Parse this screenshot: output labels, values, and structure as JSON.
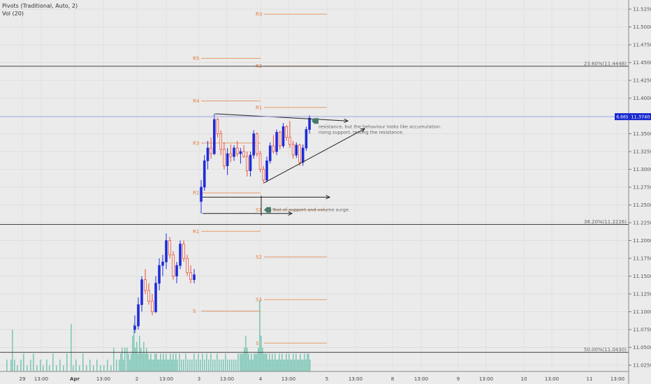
{
  "legend": {
    "pivots": "Pivots (Traditional, Auto, 2)",
    "vol": "Vol (20)"
  },
  "chart_data": {
    "type": "candlestick",
    "price_axis": {
      "ylim": [
        11.025,
        11.53
      ],
      "ticks": [
        "11.5250",
        "11.5000",
        "11.4750",
        "11.4500",
        "11.4250",
        "11.4000",
        "11.3750",
        "11.3500",
        "11.3250",
        "11.3000",
        "11.2750",
        "11.2500",
        "11.2250",
        "11.2000",
        "11.1750",
        "11.1500",
        "11.1250",
        "11.1000",
        "11.0750",
        "11.0500",
        "11.0250"
      ]
    },
    "time_axis": {
      "labels": [
        "29",
        "13:00",
        "Apr",
        "13:00",
        "2",
        "13:00",
        "3",
        "13:00",
        "4",
        "13:00",
        "5",
        "13:00",
        "8",
        "13:00",
        "9",
        "13:00",
        "10",
        "13:00",
        "11",
        "13:00"
      ]
    },
    "current_price": {
      "countdown": "6.665",
      "price": "11.3740"
    },
    "fib_levels": [
      {
        "label": "23.60%(11.4448)",
        "value": 11.4448
      },
      {
        "label": "38.20%(11.2226)",
        "value": 11.2226
      },
      {
        "label": "50.00%(11.0430)",
        "value": 11.043
      }
    ],
    "pivot_levels": [
      {
        "label": "R3",
        "value": 11.518,
        "day": 3
      },
      {
        "label": "R5",
        "value": 11.456,
        "day": 2
      },
      {
        "label": "R2",
        "value": 11.445,
        "day": 3
      },
      {
        "label": "R4",
        "value": 11.396,
        "day": 2
      },
      {
        "label": "R1",
        "value": 11.387,
        "day": 3
      },
      {
        "label": "R3",
        "value": 11.337,
        "day": 2
      },
      {
        "label": "R2",
        "value": 11.267,
        "day": 2
      },
      {
        "label": "S1",
        "value": 11.243,
        "day": 3
      },
      {
        "label": "R1",
        "value": 11.213,
        "day": 2
      },
      {
        "label": "S2",
        "value": 11.177,
        "day": 3
      },
      {
        "label": "S3",
        "value": 11.117,
        "day": 3
      },
      {
        "label": "S",
        "value": 11.101,
        "day": 2
      },
      {
        "label": "S",
        "value": 11.056,
        "day": 3
      }
    ],
    "annotations": [
      {
        "line1": "resistance, but the behaviour looks like accumulation.",
        "line2": "rising support, testing the resistance."
      },
      {
        "line1": "Test of support and volume surge."
      }
    ],
    "candles_early": [
      [
        11.075,
        11.095,
        11.07,
        11.08
      ],
      [
        11.08,
        11.12,
        11.075,
        11.11
      ],
      [
        11.11,
        11.15,
        11.1,
        11.145
      ],
      [
        11.145,
        11.16,
        11.125,
        11.13
      ],
      [
        11.13,
        11.14,
        11.11,
        11.115
      ],
      [
        11.115,
        11.125,
        11.095,
        11.1
      ],
      [
        11.1,
        11.15,
        11.098,
        11.14
      ],
      [
        11.14,
        11.175,
        11.13,
        11.165
      ],
      [
        11.165,
        11.18,
        11.15,
        11.17
      ],
      [
        11.17,
        11.21,
        11.16,
        11.2
      ],
      [
        11.2,
        11.205,
        11.175,
        11.18
      ],
      [
        11.18,
        11.185,
        11.145,
        11.15
      ],
      [
        11.15,
        11.17,
        11.14,
        11.165
      ],
      [
        11.165,
        11.2,
        11.16,
        11.195
      ],
      [
        11.195,
        11.2,
        11.17,
        11.175
      ],
      [
        11.175,
        11.18,
        11.15,
        11.155
      ],
      [
        11.155,
        11.165,
        11.14,
        11.145
      ],
      [
        11.145,
        11.16,
        11.14,
        11.152
      ]
    ],
    "candles_triangle": [
      [
        11.255,
        11.285,
        11.238,
        11.275
      ],
      [
        11.275,
        11.32,
        11.27,
        11.312
      ],
      [
        11.312,
        11.34,
        11.3,
        11.33
      ],
      [
        11.33,
        11.345,
        11.315,
        11.322
      ],
      [
        11.322,
        11.378,
        11.32,
        11.37
      ],
      [
        11.37,
        11.372,
        11.345,
        11.35
      ],
      [
        11.35,
        11.355,
        11.32,
        11.328
      ],
      [
        11.328,
        11.338,
        11.3,
        11.305
      ],
      [
        11.305,
        11.33,
        11.292,
        11.322
      ],
      [
        11.322,
        11.335,
        11.31,
        11.318
      ],
      [
        11.318,
        11.334,
        11.312,
        11.33
      ],
      [
        11.33,
        11.34,
        11.318,
        11.322
      ],
      [
        11.322,
        11.33,
        11.308,
        11.325
      ],
      [
        11.325,
        11.334,
        11.316,
        11.318
      ],
      [
        11.318,
        11.325,
        11.29,
        11.298
      ],
      [
        11.298,
        11.325,
        11.29,
        11.32
      ],
      [
        11.32,
        11.355,
        11.315,
        11.35
      ],
      [
        11.35,
        11.352,
        11.318,
        11.322
      ],
      [
        11.322,
        11.326,
        11.296,
        11.3
      ],
      [
        11.3,
        11.305,
        11.28,
        11.285
      ],
      [
        11.285,
        11.318,
        11.282,
        11.312
      ],
      [
        11.312,
        11.338,
        11.308,
        11.333
      ],
      [
        11.333,
        11.348,
        11.322,
        11.325
      ],
      [
        11.325,
        11.356,
        11.32,
        11.352
      ],
      [
        11.352,
        11.354,
        11.328,
        11.333
      ],
      [
        11.333,
        11.365,
        11.33,
        11.36
      ],
      [
        11.36,
        11.362,
        11.34,
        11.345
      ],
      [
        11.345,
        11.368,
        11.33,
        11.335
      ],
      [
        11.335,
        11.34,
        11.315,
        11.32
      ],
      [
        11.32,
        11.338,
        11.316,
        11.334
      ],
      [
        11.334,
        11.336,
        11.305,
        11.31
      ],
      [
        11.31,
        11.335,
        11.305,
        11.33
      ],
      [
        11.33,
        11.36,
        11.326,
        11.356
      ],
      [
        11.356,
        11.376,
        11.35,
        11.372
      ]
    ],
    "volume": [
      [
        9,
        2
      ],
      [
        15,
        2
      ],
      [
        17,
        7
      ],
      [
        20,
        2
      ],
      [
        24,
        1
      ],
      [
        29,
        2
      ],
      [
        33,
        3
      ],
      [
        38,
        1
      ],
      [
        43,
        2
      ],
      [
        47,
        3
      ],
      [
        52,
        1
      ],
      [
        57,
        2
      ],
      [
        61,
        1
      ],
      [
        66,
        2
      ],
      [
        70,
        1
      ],
      [
        75,
        3
      ],
      [
        80,
        1
      ],
      [
        85,
        2
      ],
      [
        90,
        1
      ],
      [
        95,
        3
      ],
      [
        101,
        8
      ],
      [
        104,
        1
      ],
      [
        108,
        2
      ],
      [
        113,
        1
      ],
      [
        118,
        3
      ],
      [
        123,
        1
      ],
      [
        128,
        2
      ],
      [
        133,
        1
      ],
      [
        138,
        2
      ],
      [
        143,
        1
      ],
      [
        148,
        1
      ],
      [
        153,
        2
      ],
      [
        158,
        1
      ],
      [
        162,
        4
      ],
      [
        166,
        2
      ],
      [
        170,
        2
      ],
      [
        172,
        3
      ],
      [
        174,
        4
      ],
      [
        176,
        2
      ],
      [
        178,
        4
      ],
      [
        181,
        4
      ],
      [
        183,
        3
      ],
      [
        185,
        2
      ],
      [
        187,
        3
      ],
      [
        189,
        6
      ],
      [
        191,
        8
      ],
      [
        193,
        4
      ],
      [
        195,
        5
      ],
      [
        197,
        3
      ],
      [
        199,
        6
      ],
      [
        201,
        4
      ],
      [
        203,
        3
      ],
      [
        205,
        5
      ],
      [
        207,
        3
      ],
      [
        209,
        4
      ],
      [
        211,
        3
      ],
      [
        213,
        2
      ],
      [
        215,
        3
      ],
      [
        217,
        2
      ],
      [
        219,
        2
      ],
      [
        221,
        3
      ],
      [
        223,
        3
      ],
      [
        225,
        2
      ],
      [
        227,
        2
      ],
      [
        229,
        3
      ],
      [
        231,
        2
      ],
      [
        233,
        3
      ],
      [
        235,
        2
      ],
      [
        237,
        3
      ],
      [
        239,
        2
      ],
      [
        241,
        2
      ],
      [
        243,
        3
      ],
      [
        245,
        2
      ],
      [
        247,
        3
      ],
      [
        249,
        2
      ],
      [
        251,
        3
      ],
      [
        253,
        2
      ],
      [
        256,
        3
      ],
      [
        259,
        2
      ],
      [
        262,
        2
      ],
      [
        265,
        3
      ],
      [
        268,
        2
      ],
      [
        271,
        2
      ],
      [
        274,
        2
      ],
      [
        277,
        3
      ],
      [
        280,
        2
      ],
      [
        283,
        3
      ],
      [
        286,
        2
      ],
      [
        289,
        3
      ],
      [
        292,
        2
      ],
      [
        295,
        3
      ],
      [
        298,
        2
      ],
      [
        301,
        3
      ],
      [
        304,
        2
      ],
      [
        307,
        2
      ],
      [
        310,
        3
      ],
      [
        313,
        2
      ],
      [
        316,
        2
      ],
      [
        319,
        2
      ],
      [
        322,
        3
      ],
      [
        325,
        2
      ],
      [
        328,
        2
      ],
      [
        331,
        2
      ],
      [
        334,
        2
      ],
      [
        337,
        2
      ],
      [
        340,
        3
      ],
      [
        343,
        3
      ],
      [
        345,
        3
      ],
      [
        347,
        3
      ],
      [
        349,
        4
      ],
      [
        351,
        6
      ],
      [
        353,
        4
      ],
      [
        355,
        3
      ],
      [
        357,
        2
      ],
      [
        359,
        3
      ],
      [
        361,
        2
      ],
      [
        363,
        3
      ],
      [
        365,
        3
      ],
      [
        367,
        3
      ],
      [
        369,
        4
      ],
      [
        371,
        12
      ],
      [
        373,
        6
      ],
      [
        375,
        4
      ],
      [
        377,
        3
      ],
      [
        379,
        3
      ],
      [
        381,
        3
      ],
      [
        383,
        2
      ],
      [
        385,
        3
      ],
      [
        387,
        2
      ],
      [
        389,
        3
      ],
      [
        391,
        2
      ],
      [
        393,
        3
      ],
      [
        395,
        2
      ],
      [
        397,
        2
      ],
      [
        399,
        3
      ],
      [
        401,
        2
      ],
      [
        403,
        3
      ],
      [
        405,
        2
      ],
      [
        407,
        2
      ],
      [
        409,
        3
      ],
      [
        411,
        2
      ],
      [
        413,
        3
      ],
      [
        415,
        2
      ],
      [
        417,
        2
      ],
      [
        419,
        3
      ],
      [
        421,
        2
      ],
      [
        423,
        3
      ],
      [
        425,
        2
      ],
      [
        427,
        2
      ],
      [
        429,
        3
      ],
      [
        431,
        2
      ],
      [
        433,
        2
      ],
      [
        435,
        3
      ],
      [
        437,
        2
      ],
      [
        439,
        3
      ],
      [
        441,
        3
      ],
      [
        443,
        2
      ]
    ]
  }
}
